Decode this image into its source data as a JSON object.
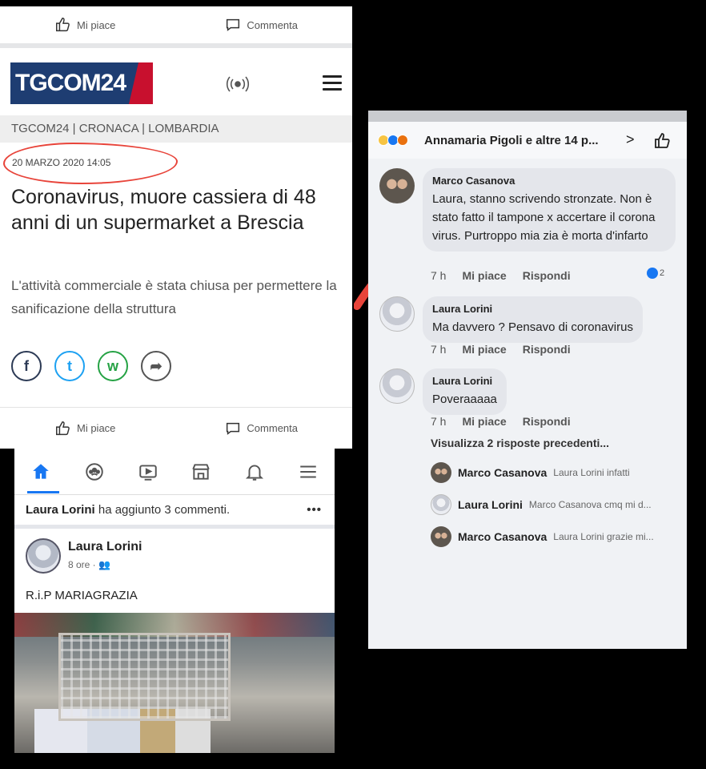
{
  "news": {
    "top_actions": {
      "like": "Mi piace",
      "comment": "Commenta"
    },
    "logo": "TGCOM24",
    "breadcrumb": "TGCOM24 | CRONACA | LOMBARDIA",
    "date": "20 MARZO 2020  14:05",
    "title": "Coronavirus, muore cassiera di 48 anni di un supermarket a Brescia",
    "subtitle": "L'attività commerciale è stata chiusa per permettere la sanificazione della struttura",
    "share": {
      "facebook": "f",
      "twitter": "t",
      "whatsapp": "w",
      "share": "➦"
    },
    "bottom_actions": {
      "like": "Mi piace",
      "comment": "Commenta"
    }
  },
  "post": {
    "notice_name": "Laura Lorini",
    "notice_text": " ha aggiunto 3 commenti.",
    "notice_more": "•••",
    "author": "Laura Lorini",
    "meta": "8 ore · 👥",
    "text": "R.i.P MARIAGRAZIA"
  },
  "comments": {
    "header": "Annamaria Pigoli e altre 14 p...",
    "header_chevron": ">",
    "items": [
      {
        "name": "Marco Casanova",
        "text": "Laura, stanno scrivendo  stronzate. Non è  stato fatto il tampone x accertare il corona virus.  Purtroppo mia zia è  morta d'infarto",
        "time": "7 h",
        "like": "Mi piace",
        "reply": "Rispondi",
        "reactions": "2"
      },
      {
        "name": "Laura Lorini",
        "text": "Ma davvero ? Pensavo di coronavirus",
        "time": "7 h",
        "like": "Mi piace",
        "reply": "Rispondi"
      },
      {
        "name": "Laura Lorini",
        "text": "Poveraaaaa",
        "time": "7 h",
        "like": "Mi piace",
        "reply": "Rispondi"
      }
    ],
    "previous": "Visualizza 2 risposte precedenti...",
    "replies": [
      {
        "name": "Marco Casanova",
        "text": "Laura Lorini infatti"
      },
      {
        "name": "Laura Lorini",
        "text": "Marco Casanova cmq mi d..."
      },
      {
        "name": "Marco Casanova",
        "text": "Laura Lorini grazie mi..."
      }
    ]
  },
  "colors": {
    "tgcom_blue": "#1e3d72",
    "tgcom_red": "#c8102e",
    "fb_blue": "#1877f2",
    "annotation_red": "#e8443a"
  }
}
